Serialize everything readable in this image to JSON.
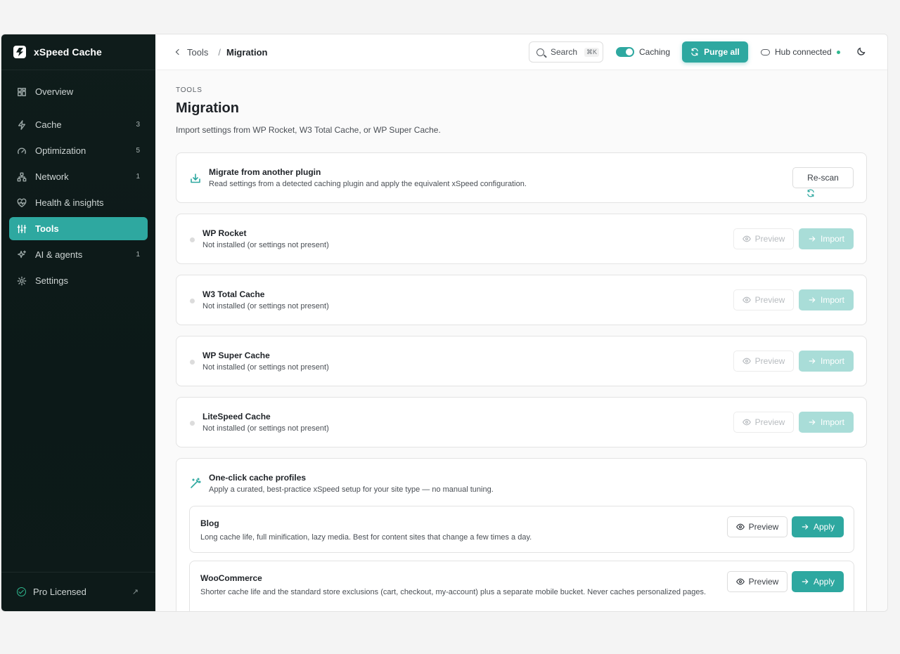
{
  "app": {
    "name": "xSpeed Cache"
  },
  "sidebar": {
    "items": [
      {
        "label": "Overview",
        "icon": "grid-icon",
        "count": ""
      },
      {
        "label": "Cache",
        "icon": "bolt-icon",
        "count": "3"
      },
      {
        "label": "Optimization",
        "icon": "gauge-icon",
        "count": "5"
      },
      {
        "label": "Network",
        "icon": "network-icon",
        "count": "1"
      },
      {
        "label": "Health & insights",
        "icon": "heart-pulse-icon",
        "count": ""
      },
      {
        "label": "Tools",
        "icon": "sliders-icon",
        "count": ""
      },
      {
        "label": "AI & agents",
        "icon": "sparkles-icon",
        "count": "1"
      },
      {
        "label": "Settings",
        "icon": "gear-icon",
        "count": ""
      }
    ],
    "active": "Tools",
    "footer": {
      "label": "Pro Licensed",
      "ext": "↗"
    }
  },
  "topbar": {
    "back_label": "Tools",
    "separator": "/",
    "current": "Migration",
    "search_label": "Search",
    "search_kbd": "⌘K",
    "caching_label": "Caching",
    "caching_on": true,
    "purge_label": "Purge all",
    "hub_label": "Hub connected",
    "accent": "#2ea8a0"
  },
  "page": {
    "eyebrow": "TOOLS",
    "title": "Migration",
    "subtitle": "Import settings from WP Rocket, W3 Total Cache, or WP Super Cache."
  },
  "migrate": {
    "title": "Migrate from another plugin",
    "desc": "Read settings from a detected caching plugin and apply the equivalent xSpeed configuration.",
    "rescan_label": "Re-scan"
  },
  "plugins": [
    {
      "name": "WP Rocket",
      "status": "Not installed (or settings not present)"
    },
    {
      "name": "W3 Total Cache",
      "status": "Not installed (or settings not present)"
    },
    {
      "name": "WP Super Cache",
      "status": "Not installed (or settings not present)"
    },
    {
      "name": "LiteSpeed Cache",
      "status": "Not installed (or settings not present)"
    }
  ],
  "plugin_actions": {
    "preview_label": "Preview",
    "import_label": "Import"
  },
  "profiles": {
    "title": "One-click cache profiles",
    "desc": "Apply a curated, best-practice xSpeed setup for your site type — no manual tuning.",
    "items": [
      {
        "name": "Blog",
        "desc": "Long cache life, full minification, lazy media. Best for content sites that change a few times a day."
      },
      {
        "name": "WooCommerce",
        "desc": "Shorter cache life and the standard store exclusions (cart, checkout, my-account) plus a separate mobile bucket. Never caches personalized pages."
      }
    ],
    "preview_label": "Preview",
    "apply_label": "Apply"
  }
}
